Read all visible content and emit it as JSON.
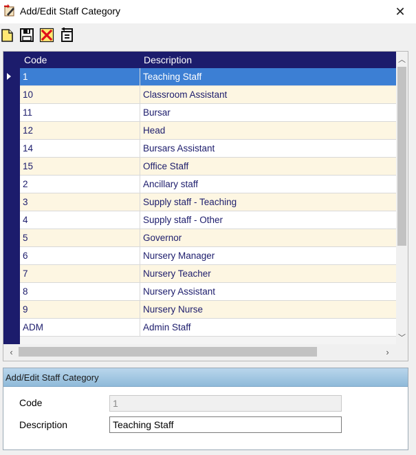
{
  "window": {
    "title": "Add/Edit Staff Category",
    "close_glyph": "✕"
  },
  "toolbar": {
    "buttons": [
      {
        "name": "new-record-icon"
      },
      {
        "name": "save-icon"
      },
      {
        "name": "delete-icon"
      },
      {
        "name": "undo-icon"
      }
    ]
  },
  "grid": {
    "columns": [
      "Code",
      "Description"
    ],
    "selected_index": 0,
    "rows": [
      {
        "code": "1",
        "description": "Teaching Staff"
      },
      {
        "code": "10",
        "description": "Classroom Assistant"
      },
      {
        "code": "11",
        "description": "Bursar"
      },
      {
        "code": "12",
        "description": "Head"
      },
      {
        "code": "14",
        "description": "Bursars Assistant"
      },
      {
        "code": "15",
        "description": "Office Staff"
      },
      {
        "code": "2",
        "description": "Ancillary staff"
      },
      {
        "code": "3",
        "description": "Supply staff - Teaching"
      },
      {
        "code": "4",
        "description": "Supply staff - Other"
      },
      {
        "code": "5",
        "description": "Governor"
      },
      {
        "code": "6",
        "description": "Nursery Manager"
      },
      {
        "code": "7",
        "description": "Nursery Teacher"
      },
      {
        "code": "8",
        "description": "Nursery Assistant"
      },
      {
        "code": "9",
        "description": "Nursery Nurse"
      },
      {
        "code": "ADM",
        "description": "Admin Staff"
      }
    ]
  },
  "editor": {
    "title": "Add/Edit Staff Category",
    "code_label": "Code",
    "code_value": "1",
    "description_label": "Description",
    "description_value": "Teaching Staff"
  },
  "colors": {
    "grid_header": "#1c1c6c",
    "row_alt": "#fdf6e2",
    "selection": "#3c7fd4"
  }
}
